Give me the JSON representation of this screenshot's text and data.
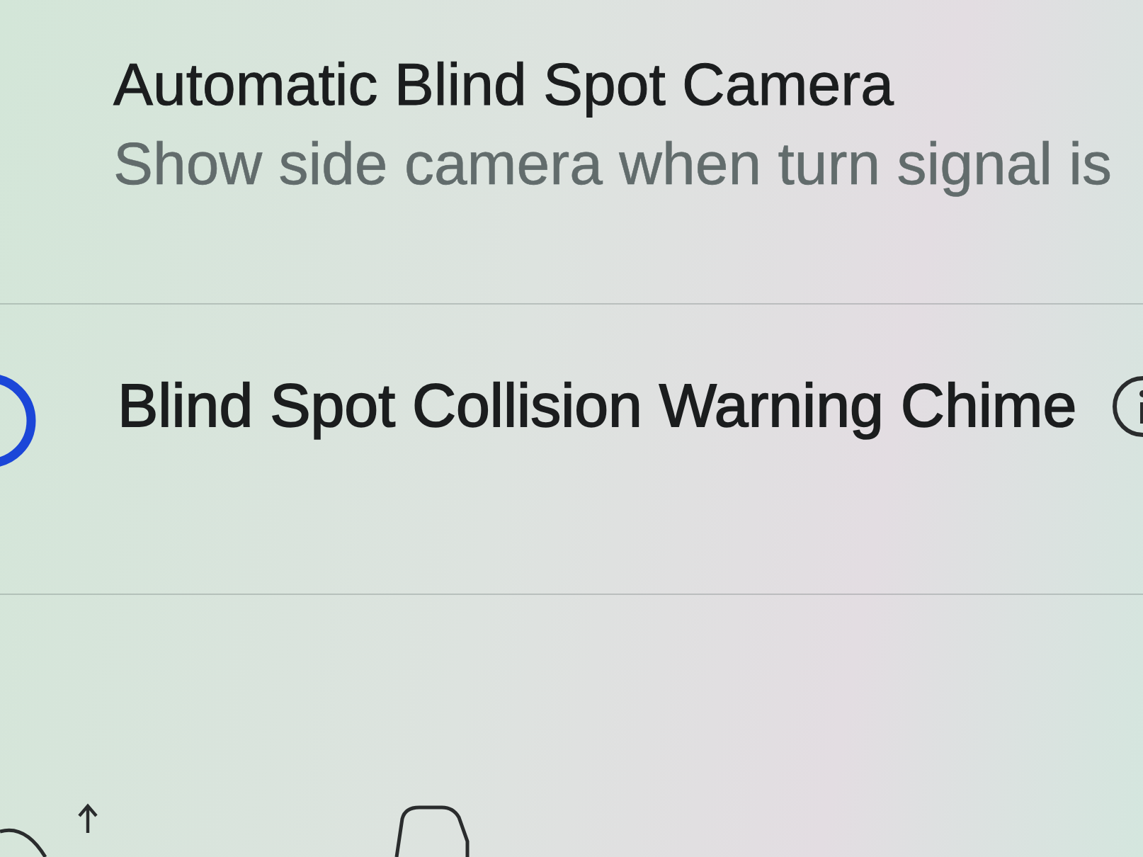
{
  "settings": [
    {
      "kind": "description",
      "title": "Automatic Blind Spot Camera",
      "subtitle": "Show side camera when turn signal is"
    },
    {
      "kind": "checkbox",
      "title": "Blind Spot Collision Warning Chime",
      "checked": false,
      "info": true
    }
  ]
}
